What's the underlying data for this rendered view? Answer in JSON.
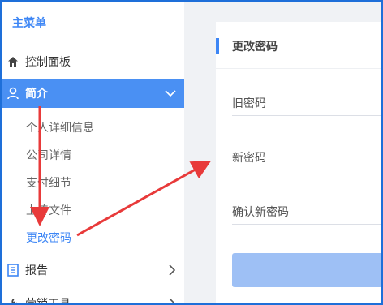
{
  "sidebar": {
    "menu_title": "主菜单",
    "items": [
      {
        "label": "控制面板",
        "icon": "home-icon"
      },
      {
        "label": "简介",
        "icon": "user-icon",
        "active": true
      },
      {
        "label": "报告",
        "icon": "report-icon"
      },
      {
        "label": "营销工具",
        "icon": "tools-icon"
      }
    ],
    "sub_items": [
      {
        "label": "个人详细信息"
      },
      {
        "label": "公司详情"
      },
      {
        "label": "支付细节"
      },
      {
        "label": "上传文件"
      },
      {
        "label": "更改密码",
        "current": true
      }
    ]
  },
  "panel": {
    "title": "更改密码",
    "fields": [
      {
        "placeholder": "旧密码"
      },
      {
        "placeholder": "新密码"
      },
      {
        "placeholder": "确认新密码"
      }
    ]
  },
  "colors": {
    "accent": "#4a90f3",
    "annotation_arrow": "#e83a3a",
    "button_disabled": "#9ec0f5"
  }
}
